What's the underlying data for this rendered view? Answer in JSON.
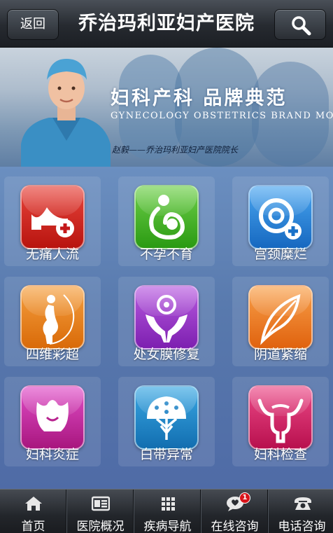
{
  "header": {
    "back_label": "返回",
    "title": "乔治玛利亚妇产医院"
  },
  "banner": {
    "slogan": "妇科产科 品牌典范",
    "slogan_en": "GYNECOLOGY OBSTETRICS BRAND MODEL",
    "signature": "赵毅——乔治玛利亚妇产医院院长"
  },
  "services": [
    {
      "label": "无痛人流",
      "icon": "abortion-icon",
      "color": "#d4231f"
    },
    {
      "label": "不孕不育",
      "icon": "mother-baby-icon",
      "color": "#3fb122"
    },
    {
      "label": "宫颈糜烂",
      "icon": "cervix-plus-icon",
      "color": "#1f7fd6"
    },
    {
      "label": "四维彩超",
      "icon": "pregnant-woman-icon",
      "color": "#e67c12"
    },
    {
      "label": "处女膜修复",
      "icon": "hands-care-icon",
      "color": "#9a2fc6"
    },
    {
      "label": "阴道紧缩",
      "icon": "feather-icon",
      "color": "#ea7a1a"
    },
    {
      "label": "妇科炎症",
      "icon": "tulip-icon",
      "color": "#c9249e"
    },
    {
      "label": "白带异常",
      "icon": "tree-icon",
      "color": "#1c8fd0"
    },
    {
      "label": "妇科检查",
      "icon": "uterus-icon",
      "color": "#d51b62"
    }
  ],
  "footer": {
    "items": [
      {
        "label": "首页",
        "icon": "home-icon"
      },
      {
        "label": "医院概况",
        "icon": "card-icon"
      },
      {
        "label": "疾病导航",
        "icon": "grid-icon"
      },
      {
        "label": "在线咨询",
        "icon": "chat-icon",
        "badge": "1"
      },
      {
        "label": "电话咨询",
        "icon": "phone-icon"
      }
    ]
  }
}
